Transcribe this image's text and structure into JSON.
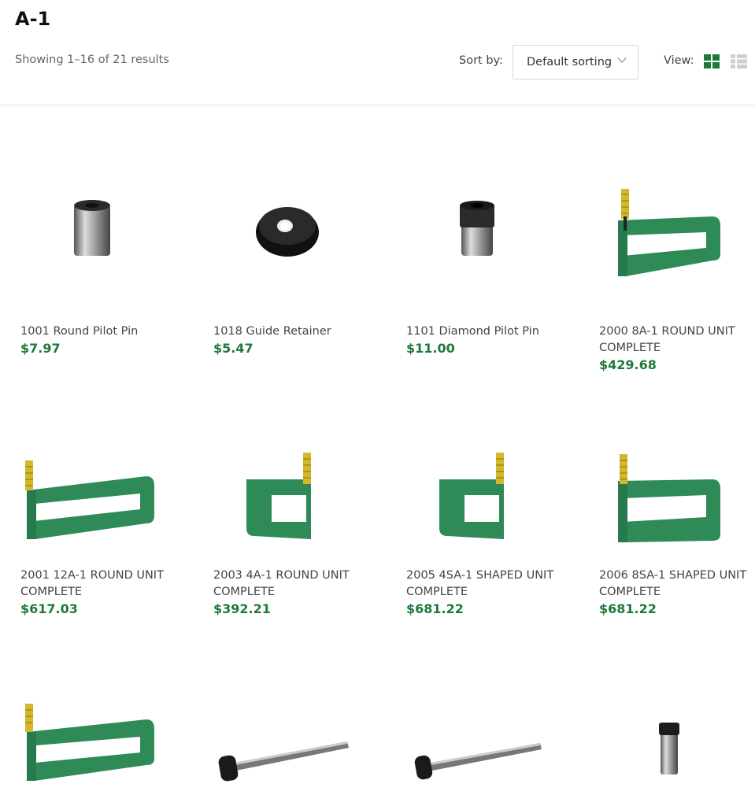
{
  "page": {
    "title": "A-1"
  },
  "toolbar": {
    "result_count": "Showing 1–16 of 21 results",
    "sort_label": "Sort by:",
    "sort_value": "Default sorting",
    "view_label": "View:"
  },
  "colors": {
    "accent": "#1e7a3a",
    "frame_green": "#2e8b57",
    "icon_inactive": "#cccccc"
  },
  "products": [
    {
      "name": "1001 Round Pilot Pin",
      "price": "$7.97"
    },
    {
      "name": "1018 Guide Retainer",
      "price": "$5.47"
    },
    {
      "name": "1101 Diamond Pilot Pin",
      "price": "$11.00"
    },
    {
      "name": "2000 8A-1 ROUND UNIT COMPLETE",
      "price": "$429.68"
    },
    {
      "name": "2001 12A-1 ROUND UNIT COMPLETE",
      "price": "$617.03"
    },
    {
      "name": "2003 4A-1 ROUND UNIT COMPLETE",
      "price": "$392.21"
    },
    {
      "name": "2005 4SA-1 SHAPED UNIT COMPLETE",
      "price": "$681.22"
    },
    {
      "name": "2006 8SA-1 SHAPED UNIT COMPLETE",
      "price": "$681.22"
    }
  ]
}
